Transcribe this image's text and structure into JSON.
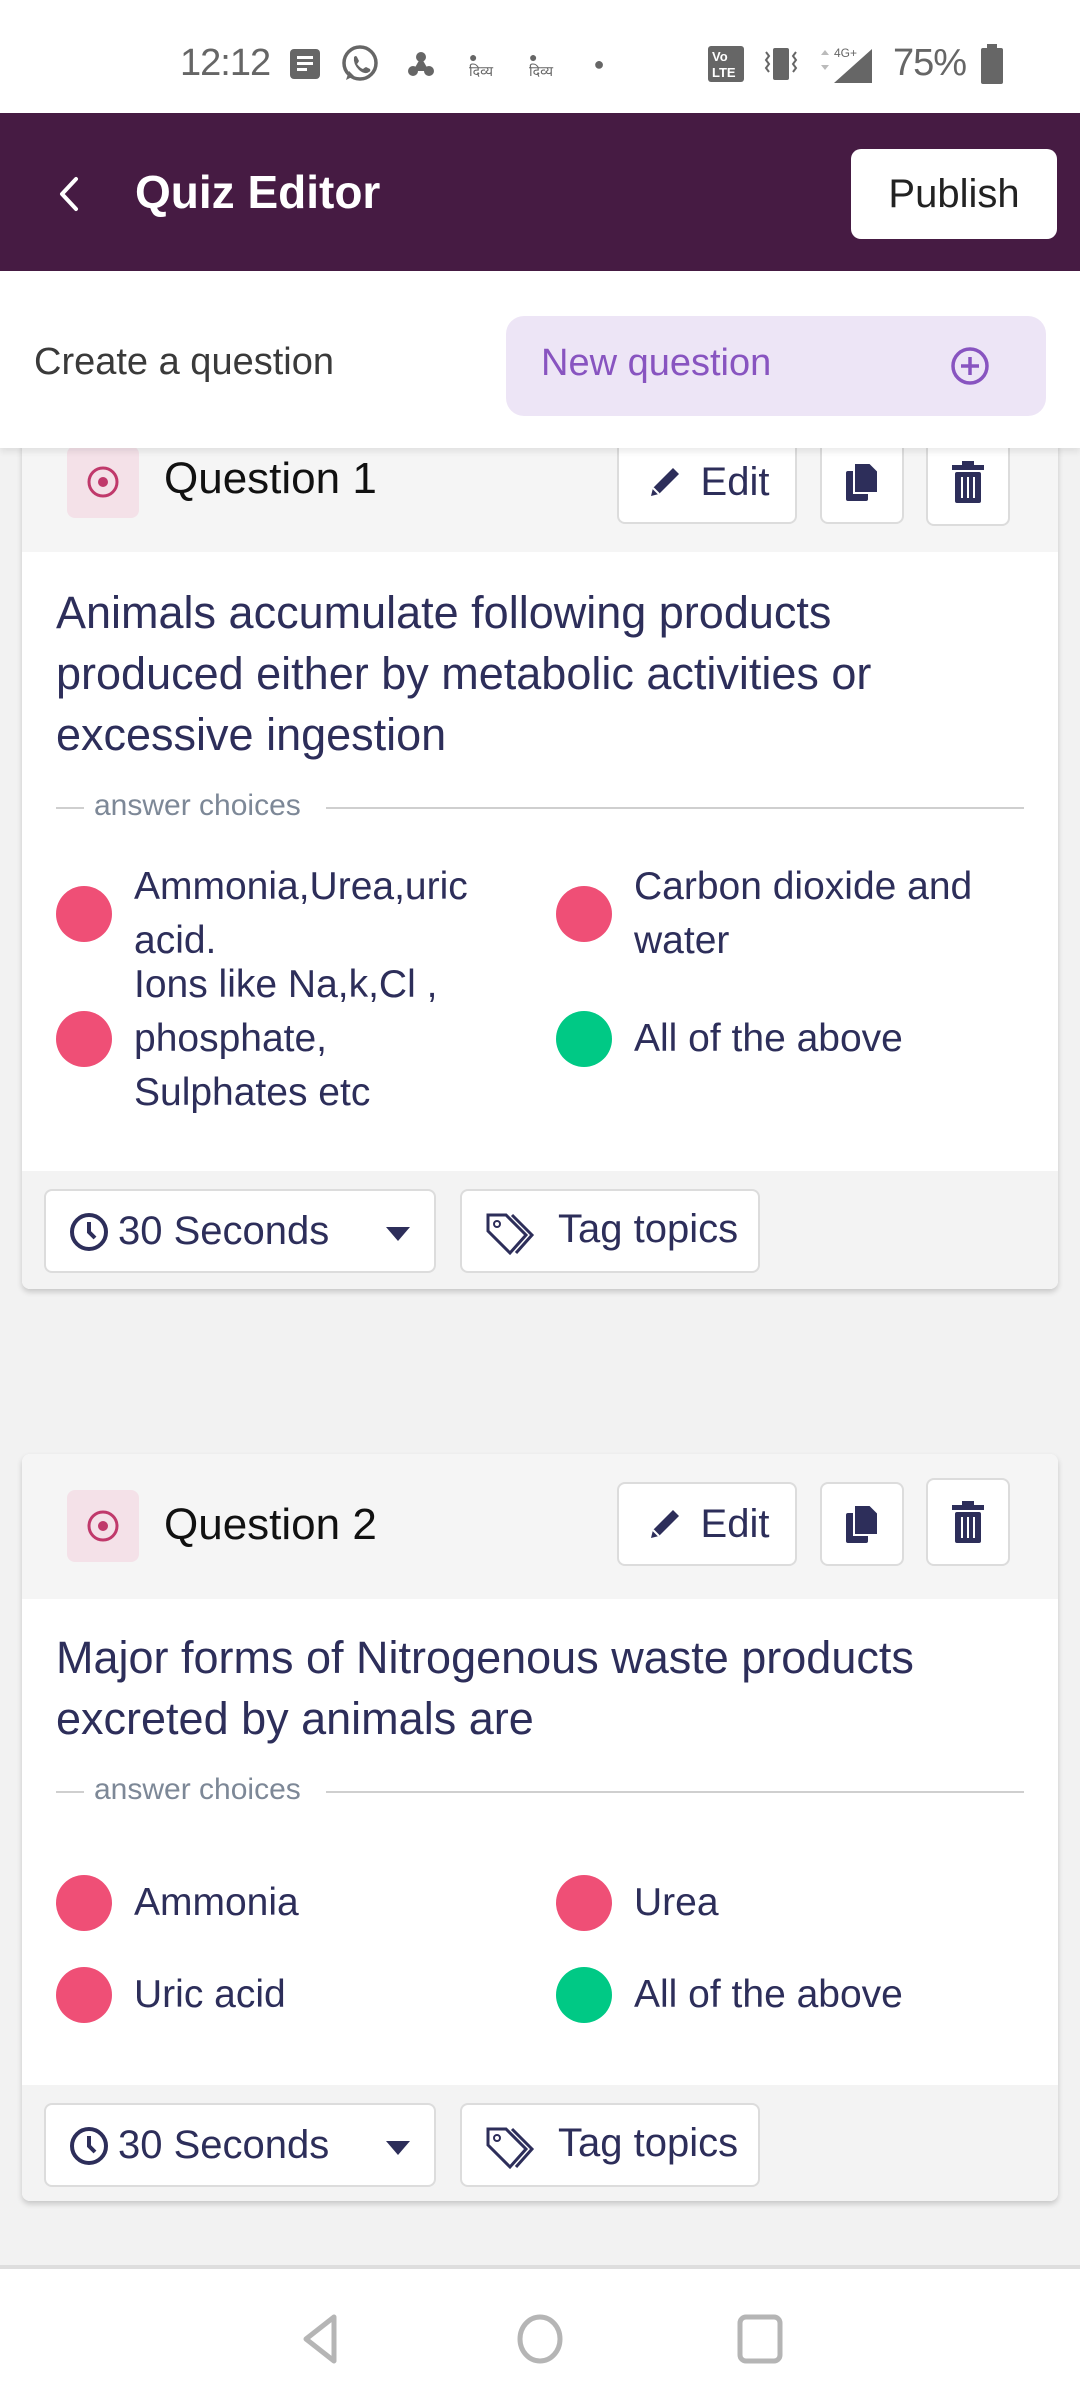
{
  "status_bar": {
    "time": "12:12",
    "battery": "75%",
    "network": "4G+",
    "icons": [
      "notification-icon",
      "whatsapp-icon",
      "app-icon",
      "news-app-icon",
      "news-app-icon",
      "dot-icon",
      "volte-icon",
      "vibrate-icon",
      "signal-icon",
      "battery-icon"
    ]
  },
  "header": {
    "title": "Quiz Editor",
    "publish_label": "Publish",
    "color": "#461b43"
  },
  "create_bar": {
    "label": "Create a question",
    "new_question_label": "New question"
  },
  "questions": [
    {
      "title": "Question 1",
      "edit_label": "Edit",
      "text": "Animals accumulate following products produced either by metabolic activities or excessive ingestion",
      "choices_label": "answer choices",
      "choices": [
        {
          "text": "Ammonia,Urea,uric acid.",
          "correct": false
        },
        {
          "text": "Carbon dioxide and water",
          "correct": false
        },
        {
          "text": "Ions like Na,k,Cl , phosphate, Sulphates etc",
          "correct": false
        },
        {
          "text": "All of the above",
          "correct": true
        }
      ],
      "time_limit": "30 Seconds",
      "tag_label": "Tag topics"
    },
    {
      "title": "Question 2",
      "edit_label": "Edit",
      "text": "Major forms of Nitrogenous waste products excreted by animals are",
      "choices_label": "answer choices",
      "choices": [
        {
          "text": "Ammonia",
          "correct": false
        },
        {
          "text": "Urea",
          "correct": false
        },
        {
          "text": "Uric acid",
          "correct": false
        },
        {
          "text": "All of the above",
          "correct": true
        }
      ],
      "time_limit": "30 Seconds",
      "tag_label": "Tag topics"
    }
  ],
  "colors": {
    "correct": "#00c985",
    "incorrect": "#ef4f76",
    "accent": "#8854c0"
  }
}
